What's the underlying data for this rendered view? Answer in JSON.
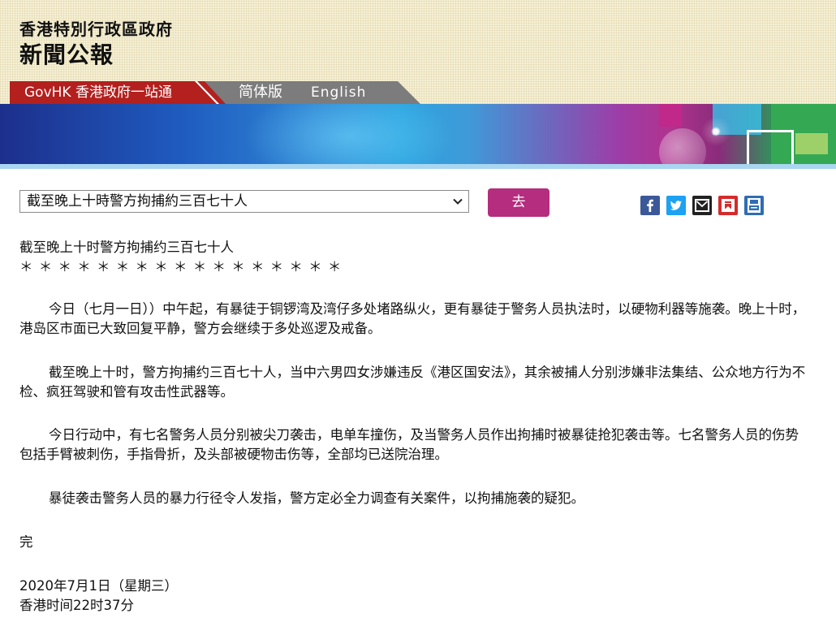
{
  "header": {
    "government_name": "香港特別行政區政府",
    "publication_name": "新聞公報"
  },
  "nav": {
    "govhk": "GovHK 香港政府一站通",
    "simplified": "简体版",
    "english": "English"
  },
  "toolbar": {
    "selected_title": "截至晚上十時警方拘捕約三百七十人",
    "go_label": "去",
    "share_icons": [
      "facebook-icon",
      "twitter-icon",
      "email-icon",
      "weibo-icon",
      "print-icon"
    ]
  },
  "article": {
    "title": "截至晚上十时警方拘捕约三百七十人",
    "stars": "＊ ＊ ＊ ＊ ＊ ＊ ＊ ＊ ＊ ＊ ＊ ＊ ＊ ＊ ＊ ＊ ＊",
    "paragraphs": [
      "今日（七月一日））中午起，有暴徒于铜锣湾及湾仔多处堵路纵火，更有暴徒于警务人员执法时，以硬物利器等施袭。晚上十时，港岛区市面已大致回复平静，警方会继续于多处巡逻及戒备。",
      "截至晚上十时，警方拘捕约三百七十人，当中六男四女涉嫌违反《港区国安法》，其余被捕人分别涉嫌非法集结、公众地方行为不检、疯狂驾驶和管有攻击性武器等。",
      "今日行动中，有七名警务人员分别被尖刀袭击，电单车撞伤，及当警务人员作出拘捕时被暴徒抢犯袭击等。七名警务人员的伤势包括手臂被刺伤，手指骨折，及头部被硬物击伤等，全部均已送院治理。",
      "暴徒袭击警务人员的暴力行径令人发指，警方定必全力调查有关案件，以拘捕施袭的疑犯。"
    ],
    "end_mark": "完",
    "date": "2020年7月1日（星期三）",
    "time": "香港时间22时37分"
  }
}
